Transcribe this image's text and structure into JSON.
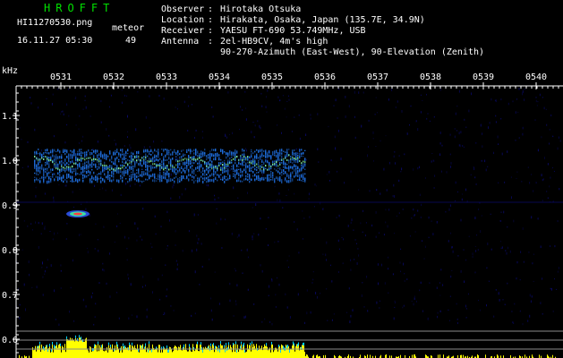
{
  "header": {
    "brand": "HROFFT",
    "filename": "HI11270530.png",
    "timestamp": "16.11.27 05:30",
    "meteor_label": "meteor",
    "meteor_count": "49"
  },
  "station_info": [
    {
      "label": "Observer",
      "value": "Hirotaka Otsuka"
    },
    {
      "label": "Location",
      "value": "Hirakata, Osaka, Japan (135.7E, 34.9N)"
    },
    {
      "label": "Receiver",
      "value": "YAESU FT-690 53.749MHz, USB"
    },
    {
      "label": "Antenna",
      "value": "2el-HB9CV, 4m's high"
    }
  ],
  "antenna_extra": "90-270-Azimuth (East-West), 90-Elevation (Zenith)",
  "axis": {
    "y_unit": "kHz",
    "y_ticks": [
      "1.1",
      "1.0",
      "0.9",
      "0.8",
      "0.7",
      "0.6"
    ],
    "x_ticks": [
      "0531",
      "0532",
      "0533",
      "0534",
      "0535",
      "0536",
      "0537",
      "0538",
      "0539",
      "0540"
    ]
  },
  "colors": {
    "background": "#000000",
    "brand": "#00e000",
    "text": "#ffffff",
    "axis": "#ffffff",
    "noise": "#0a0a66",
    "signal": "#1f6fe0",
    "signal_hot": "#7ff0a0",
    "meteor_core": "#ff4040",
    "level": "#ffff00",
    "level_high": "#00d0ff"
  }
}
